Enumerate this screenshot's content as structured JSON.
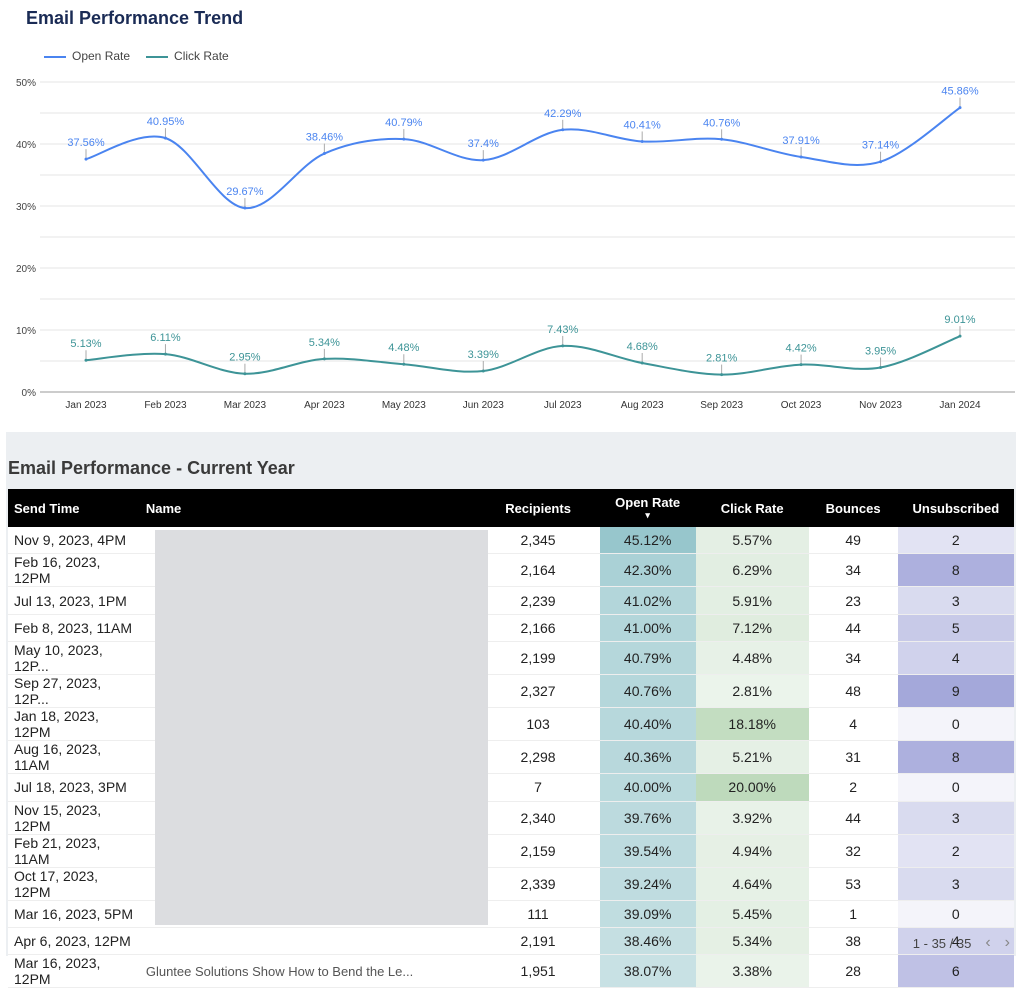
{
  "chart_data": {
    "type": "line",
    "title": "Email Performance Trend",
    "categories": [
      "Jan 2023",
      "Feb 2023",
      "Mar 2023",
      "Apr 2023",
      "May 2023",
      "Jun 2023",
      "Jul 2023",
      "Aug 2023",
      "Sep 2023",
      "Oct 2023",
      "Nov 2023",
      "Jan 2024"
    ],
    "series": [
      {
        "name": "Open Rate",
        "color": "#4a84f0",
        "values": [
          37.56,
          40.95,
          29.67,
          38.46,
          40.79,
          37.4,
          42.29,
          40.41,
          40.76,
          37.91,
          37.14,
          45.86
        ],
        "labels": [
          "37.56%",
          "40.95%",
          "29.67%",
          "38.46%",
          "40.79%",
          "37.4%",
          "42.29%",
          "40.41%",
          "40.76%",
          "37.91%",
          "37.14%",
          "45.86%"
        ]
      },
      {
        "name": "Click Rate",
        "color": "#3d9497",
        "values": [
          5.13,
          6.11,
          2.95,
          5.34,
          4.48,
          3.39,
          7.43,
          4.68,
          2.81,
          4.42,
          3.95,
          9.01
        ],
        "labels": [
          "5.13%",
          "6.11%",
          "2.95%",
          "5.34%",
          "4.48%",
          "3.39%",
          "7.43%",
          "4.68%",
          "2.81%",
          "4.42%",
          "3.95%",
          "9.01%"
        ]
      }
    ],
    "yticks": [
      "0%",
      "10%",
      "20%",
      "30%",
      "40%",
      "50%"
    ],
    "ylim": [
      0,
      50
    ],
    "grid": true,
    "legend": "top-left"
  },
  "table": {
    "title": "Email Performance - Current Year",
    "columns": [
      "Send Time",
      "Name",
      "Recipients",
      "Open Rate",
      "Click Rate",
      "Bounces",
      "Unsubscribed"
    ],
    "sort_indicator": "▾",
    "rows": [
      [
        "Nov 9, 2023, 4PM",
        "",
        "2,345",
        "45.12%",
        "5.57%",
        "49",
        "2"
      ],
      [
        "Feb 16, 2023, 12PM",
        "",
        "2,164",
        "42.30%",
        "6.29%",
        "34",
        "8"
      ],
      [
        "Jul 13, 2023, 1PM",
        "",
        "2,239",
        "41.02%",
        "5.91%",
        "23",
        "3"
      ],
      [
        "Feb 8, 2023, 11AM",
        "",
        "2,166",
        "41.00%",
        "7.12%",
        "44",
        "5"
      ],
      [
        "May 10, 2023, 12P...",
        "",
        "2,199",
        "40.79%",
        "4.48%",
        "34",
        "4"
      ],
      [
        "Sep 27, 2023, 12P...",
        "",
        "2,327",
        "40.76%",
        "2.81%",
        "48",
        "9"
      ],
      [
        "Jan 18, 2023, 12PM",
        "",
        "103",
        "40.40%",
        "18.18%",
        "4",
        "0"
      ],
      [
        "Aug 16, 2023, 11AM",
        "",
        "2,298",
        "40.36%",
        "5.21%",
        "31",
        "8"
      ],
      [
        "Jul 18, 2023, 3PM",
        "",
        "7",
        "40.00%",
        "20.00%",
        "2",
        "0"
      ],
      [
        "Nov 15, 2023, 12PM",
        "",
        "2,340",
        "39.76%",
        "3.92%",
        "44",
        "3"
      ],
      [
        "Feb 21, 2023, 11AM",
        "",
        "2,159",
        "39.54%",
        "4.94%",
        "32",
        "2"
      ],
      [
        "Oct 17, 2023, 12PM",
        "",
        "2,339",
        "39.24%",
        "4.64%",
        "53",
        "3"
      ],
      [
        "Mar 16, 2023, 5PM",
        "",
        "111",
        "39.09%",
        "5.45%",
        "1",
        "0"
      ],
      [
        "Apr 6, 2023, 12PM",
        "",
        "2,191",
        "38.46%",
        "5.34%",
        "38",
        "4"
      ],
      [
        "Mar 16, 2023, 12PM",
        "Gluntee Solutions Show How to Bend the Le...",
        "1,951",
        "38.07%",
        "3.38%",
        "28",
        "6"
      ]
    ],
    "pagination": "1 - 35 / 35"
  }
}
